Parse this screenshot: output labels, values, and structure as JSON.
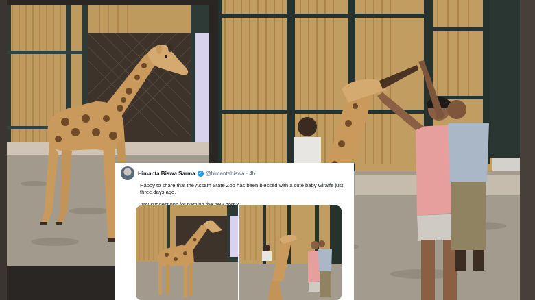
{
  "tweet": {
    "author_name": "Himanta Biswa Sarma",
    "handle": "@himantabiswa",
    "separator": "·",
    "time": "4h",
    "text_line1": "Happy to share that the Assam State Zoo has been blessed with a cute baby Giraffe just three days ago.",
    "text_line2": "Any suggestions for naming the new born?"
  },
  "icons": {
    "verified": "verified-badge-icon",
    "avatar": "profile-avatar"
  },
  "colors": {
    "background": "#2a2623",
    "card": "#ffffff",
    "verified": "#1d9bf0",
    "bamboo": "#c9a36a",
    "sand": "#a9a196"
  }
}
